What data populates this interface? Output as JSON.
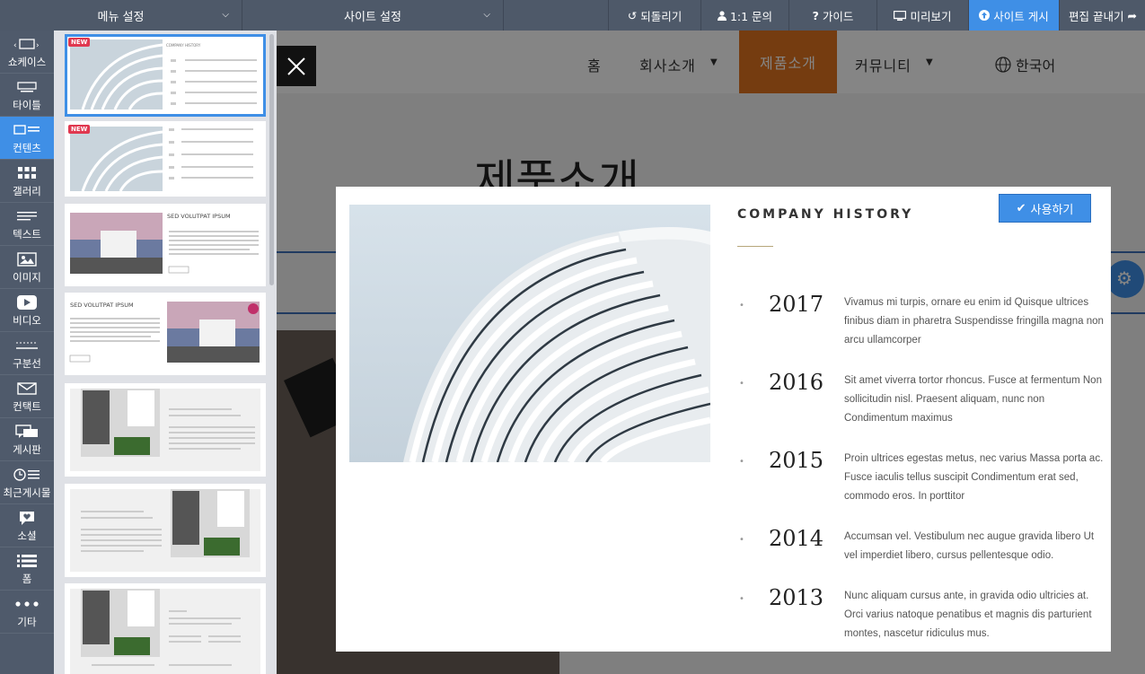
{
  "topbar": {
    "menu_settings": "메뉴 설정",
    "site_settings": "사이트 설정",
    "undo": "되돌리기",
    "inquiry": "1:1 문의",
    "guide": "가이드",
    "preview": "미리보기",
    "publish": "사이트 게시",
    "finish_edit": "편집 끝내기"
  },
  "sidebar": {
    "items": [
      {
        "label": "쇼케이스",
        "icon": "showcase-icon"
      },
      {
        "label": "타이틀",
        "icon": "title-icon"
      },
      {
        "label": "컨텐츠",
        "icon": "contents-icon",
        "active": true
      },
      {
        "label": "갤러리",
        "icon": "gallery-icon"
      },
      {
        "label": "텍스트",
        "icon": "text-icon"
      },
      {
        "label": "이미지",
        "icon": "image-icon"
      },
      {
        "label": "비디오",
        "icon": "video-icon"
      },
      {
        "label": "구분선",
        "icon": "divider-icon"
      },
      {
        "label": "컨택트",
        "icon": "mail-icon"
      },
      {
        "label": "게시판",
        "icon": "board-icon"
      },
      {
        "label": "최근게시물",
        "icon": "recent-posts-icon"
      },
      {
        "label": "소셜",
        "icon": "heart-bubble-icon"
      },
      {
        "label": "폼",
        "icon": "list-icon"
      },
      {
        "label": "기타",
        "icon": "more-icon"
      }
    ]
  },
  "templates": {
    "new_badge": "NEW",
    "card3_title": "SED VOLUTPAT IPSUM",
    "card4_title": "SED VOLUTPAT IPSUM",
    "card1_heading": "COMPANY HISTORY",
    "card3_button": "VIEW MORE",
    "card4_button": "VIEW MORE",
    "card1_years": [
      "2017",
      "2016",
      "2015",
      "2014",
      "2013"
    ],
    "card2_years": [
      "2017",
      "2016",
      "2015",
      "2014",
      "2013"
    ]
  },
  "site": {
    "nav": [
      "홈",
      "회사소개",
      "제품소개",
      "커뮤니티"
    ],
    "language": "한국어",
    "page_title": "제품소개"
  },
  "modal": {
    "use_button": "사용하기",
    "title": "COMPANY HISTORY",
    "history": [
      {
        "year": "2017",
        "text": "Vivamus mi turpis, ornare eu enim id Quisque ultrices finibus diam in pharetra Suspendisse fringilla magna non arcu ullamcorper"
      },
      {
        "year": "2016",
        "text": "Sit amet viverra tortor rhoncus. Fusce at fermentum Non sollicitudin nisl. Praesent aliquam, nunc non Condimentum maximus"
      },
      {
        "year": "2015",
        "text": "Proin ultrices egestas metus, nec varius Massa porta ac. Fusce iaculis tellus suscipit Condimentum erat sed, commodo eros. In porttitor"
      },
      {
        "year": "2014",
        "text": "Accumsan vel. Vestibulum nec augue gravida libero Ut vel imperdiet libero, cursus pellentesque odio."
      },
      {
        "year": "2013",
        "text": "Nunc aliquam cursus ante, in gravida odio ultricies at. Orci varius natoque penatibus et magnis dis parturient montes, nascetur ridiculus mus."
      }
    ]
  },
  "colors": {
    "topbar": "#4e5969",
    "accent": "#3f8fe6",
    "nav_active": "#e0731f",
    "new_badge": "#e0384f"
  }
}
